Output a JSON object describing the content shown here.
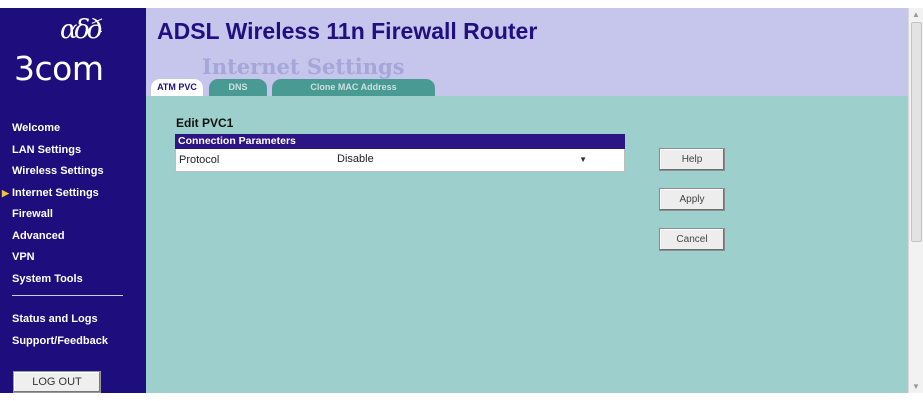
{
  "brand": {
    "mark": "ɑδð",
    "mark_suffix": ".",
    "name": "3com"
  },
  "header": {
    "app_title": "ADSL Wireless 11n Firewall Router",
    "page_title": "Internet Settings"
  },
  "tabs": [
    {
      "label": "ATM PVC",
      "active": true
    },
    {
      "label": "DNS",
      "active": false
    },
    {
      "label": "Clone MAC Address",
      "active": false
    }
  ],
  "sidebar": {
    "items": [
      {
        "label": "Welcome"
      },
      {
        "label": "LAN Settings"
      },
      {
        "label": "Wireless Settings"
      },
      {
        "label": "Internet Settings",
        "selected": true
      },
      {
        "label": "Firewall"
      },
      {
        "label": "Advanced"
      },
      {
        "label": "VPN"
      },
      {
        "label": "System Tools"
      }
    ],
    "items2": [
      {
        "label": "Status and Logs"
      },
      {
        "label": "Support/Feedback"
      }
    ],
    "logout_label": "LOG OUT",
    "selected_marker": "▶"
  },
  "form": {
    "edit_title": "Edit PVC1",
    "section_header": "Connection Parameters",
    "protocol_label": "Protocol",
    "protocol_value": "Disable",
    "dropdown_caret": "▼"
  },
  "buttons": {
    "help": "Help",
    "apply": "Apply",
    "cancel": "Cancel"
  },
  "colors": {
    "sidebar": "#1e0d7c",
    "header": "#c6c5ec",
    "content": "#9dcfcc",
    "section_header": "#2c1585",
    "title": "#1f0f80"
  }
}
